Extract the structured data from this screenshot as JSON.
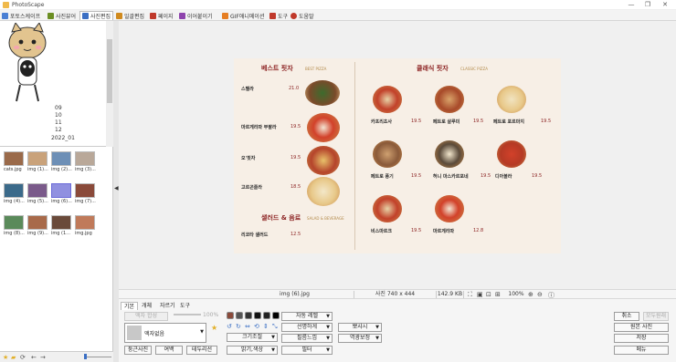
{
  "window": {
    "title": "PhotoScape",
    "minimize": "—",
    "maximize": "❐",
    "close": "✕"
  },
  "tabs": [
    {
      "label": "포토스케이프",
      "color": "#4a7fd4"
    },
    {
      "label": "사진뷰어",
      "color": "#6b8e23"
    },
    {
      "label": "사진편집",
      "color": "#3b6fc4",
      "active": true
    },
    {
      "label": "일괄편집",
      "color": "#d08a1e"
    },
    {
      "label": "페이지",
      "color": "#c0392b"
    },
    {
      "label": "이어붙이기",
      "color": "#8e44ad"
    },
    {
      "label": "GIF애니메이션",
      "color": "#e67e22"
    },
    {
      "label": "도움말",
      "color": "#c0392b"
    }
  ],
  "tree": {
    "items": [
      "09",
      "10",
      "11",
      "12",
      "2022_01"
    ]
  },
  "thumbnails": [
    {
      "caption": "cats.jpg",
      "color": "#9a6a4a"
    },
    {
      "caption": "img (1)...",
      "color": "#c9a27a"
    },
    {
      "caption": "img (2)...",
      "color": "#6d8fb6"
    },
    {
      "caption": "img (3)...",
      "color": "#b9a899"
    },
    {
      "caption": "img (4)...",
      "color": "#3b6a8a"
    },
    {
      "caption": "img (5)...",
      "color": "#7a5a8a"
    },
    {
      "caption": "img (6)...",
      "color": "#9090e0"
    },
    {
      "caption": "img (7)...",
      "color": "#8a4a3a"
    },
    {
      "caption": "img (8)...",
      "color": "#5a8a5a"
    },
    {
      "caption": "img (9)...",
      "color": "#a86a4a"
    },
    {
      "caption": "img (1...",
      "color": "#6a4a3a"
    },
    {
      "caption": "img.jpg",
      "color": "#c07a5a"
    }
  ],
  "photo": {
    "best_title": "베스트 핏자",
    "best_sub": "BEST PIZZA",
    "classic_title": "클래식 핏자",
    "classic_sub": "CLASSIC PIZZA",
    "best_items": [
      {
        "name": "스텔라",
        "price": "21.0"
      },
      {
        "name": "마르게리따 부팔라",
        "price": "19.5"
      },
      {
        "name": "오'핏자",
        "price": "19.5"
      },
      {
        "name": "고르곤졸라",
        "price": "18.5"
      }
    ],
    "salad_title": "샐러드 & 음료",
    "salad_sub": "SALAD & BEVERAGE",
    "salad_item": {
      "name": "리코타 샐러드",
      "price": "12.5"
    },
    "classic_items": [
      {
        "name": "카프리초사",
        "price": "19.5"
      },
      {
        "name": "페트로 살루미",
        "price": "19.5"
      },
      {
        "name": "페트로 포르마지",
        "price": "19.5"
      },
      {
        "name": "페트로 풍기",
        "price": "19.5"
      },
      {
        "name": "허니 마스카르포네",
        "price": "19.5"
      },
      {
        "name": "디아볼라",
        "price": "19.5"
      },
      {
        "name": "비스마르크",
        "price": "19.5"
      },
      {
        "name": "마르게리따",
        "price": "12.8"
      }
    ]
  },
  "status": {
    "filename": "img (6).jpg",
    "dimensions": "사진 740 x 444",
    "filesize": "142.9 KB",
    "zoom": "100%"
  },
  "edit_tabs": [
    "기본",
    "개체",
    "자르기",
    "도구"
  ],
  "edit": {
    "frame_button": "액자 합성",
    "frame_zoom": "100%",
    "frame_select": "액자없음",
    "btn_rounded": "둥근사진",
    "btn_margin": "여백",
    "btn_filmeffect": "테두리선",
    "btn_autolevel": "자동 레벨",
    "btn_sharpen": "선명하게",
    "btn_sharp2": "뽀샤시",
    "btn_resize": "크기조절",
    "btn_film": "필름느낌",
    "btn_backlight": "역광보정",
    "btn_brightness": "밝기,색상",
    "btn_filter": "필터",
    "btn_cancel": "취소",
    "btn_undo_all": "모두원래",
    "btn_compare": "원본 사진",
    "btn_save": "저장",
    "btn_menu": "메뉴"
  }
}
